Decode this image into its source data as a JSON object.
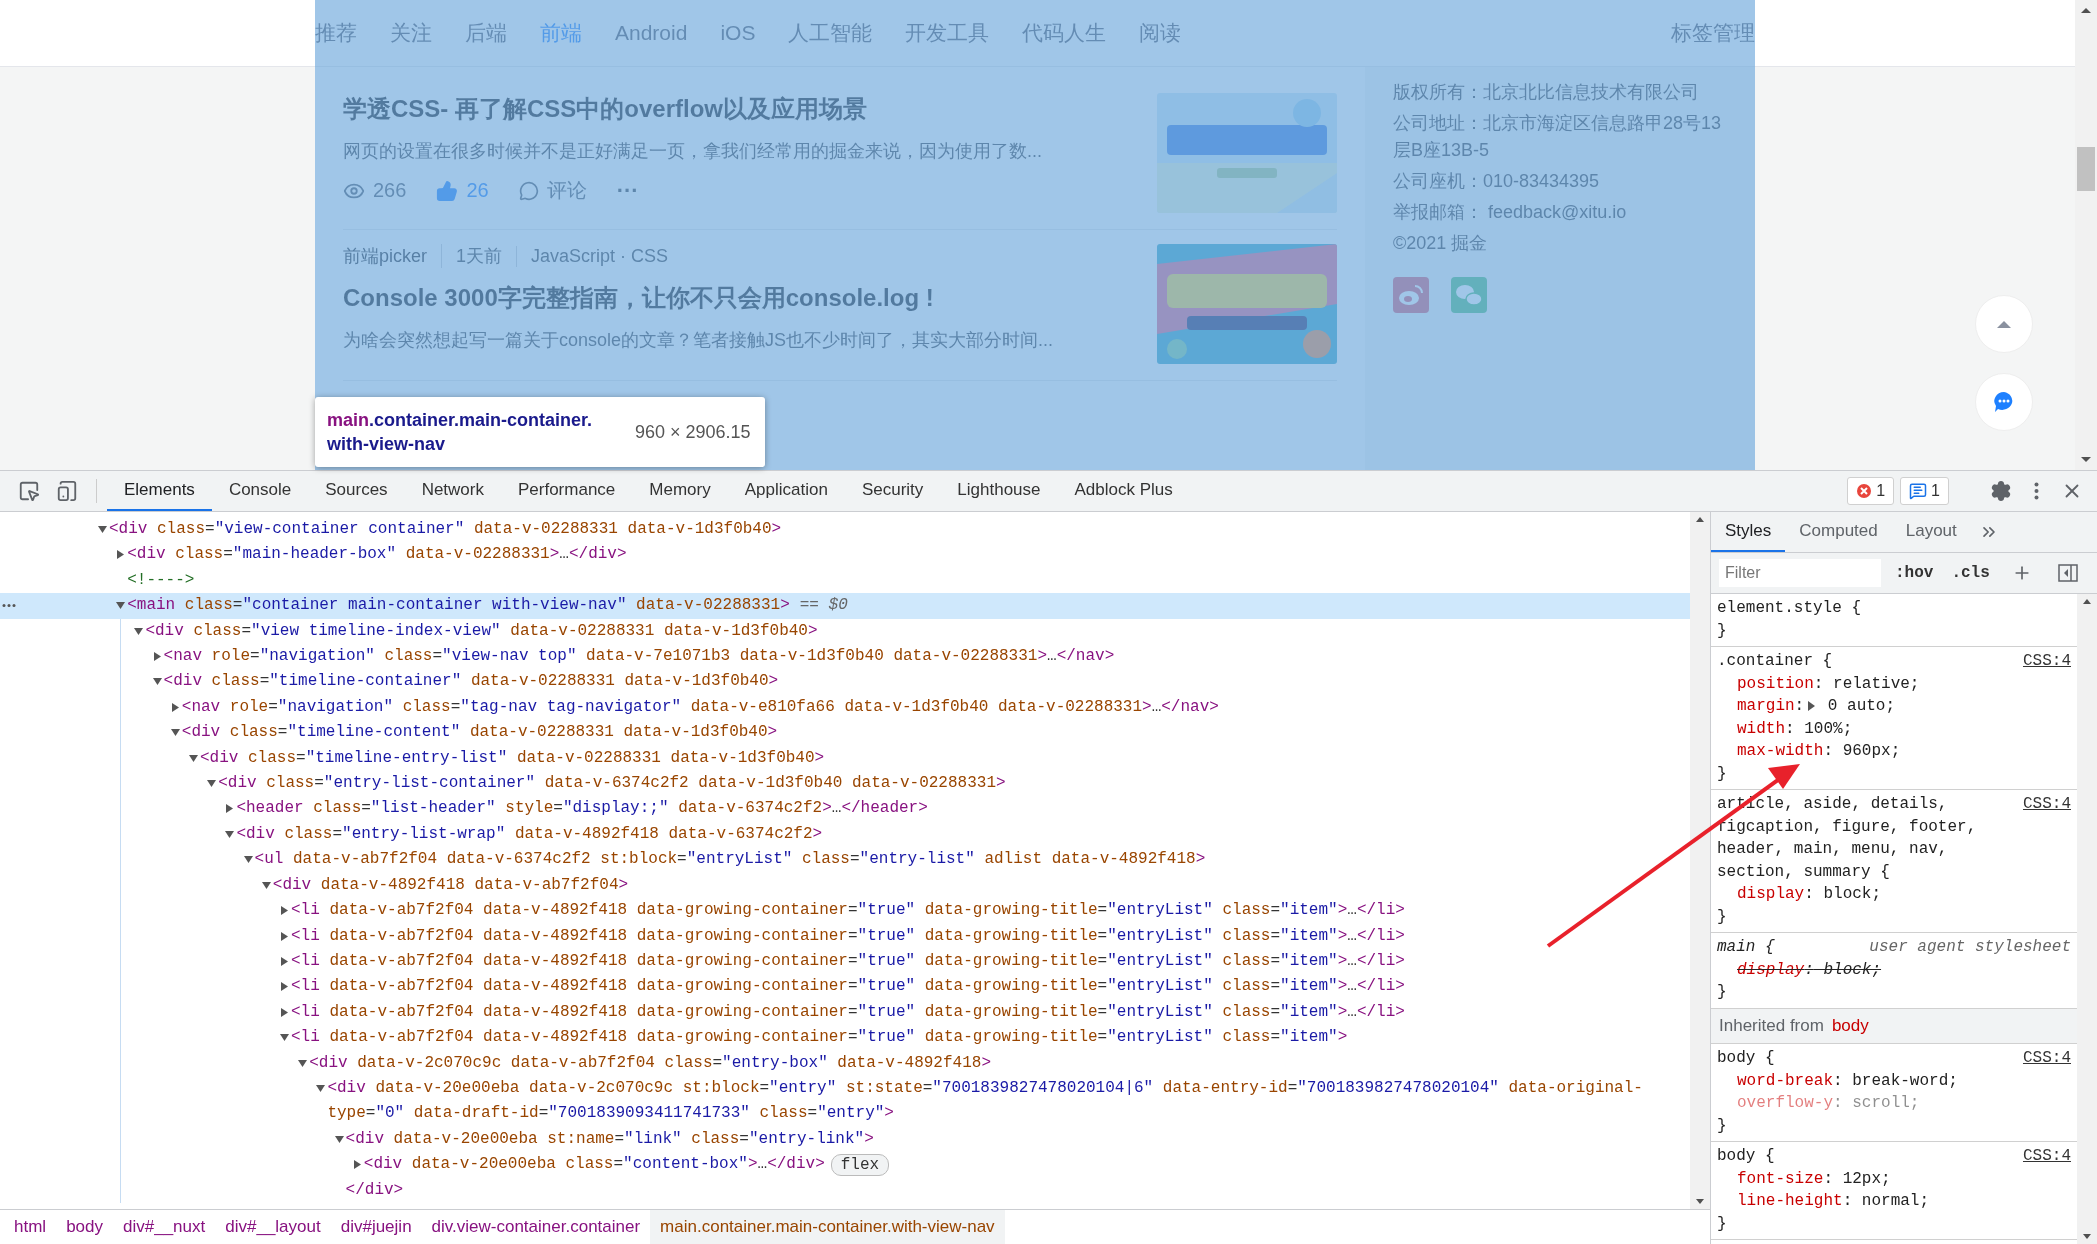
{
  "page": {
    "nav": [
      {
        "label": "推荐",
        "selected": false
      },
      {
        "label": "关注",
        "selected": false
      },
      {
        "label": "后端",
        "selected": false
      },
      {
        "label": "前端",
        "selected": true
      },
      {
        "label": "Android",
        "selected": false
      },
      {
        "label": "iOS",
        "selected": false
      },
      {
        "label": "人工智能",
        "selected": false
      },
      {
        "label": "开发工具",
        "selected": false
      },
      {
        "label": "代码人生",
        "selected": false
      },
      {
        "label": "阅读",
        "selected": false
      }
    ],
    "nav_link": "标签管理",
    "articles": [
      {
        "title": "学透CSS- 再了解CSS中的overflow以及应用场景",
        "excerpt": "网页的设置在很多时候并不是正好满足一页，拿我们经常用的掘金来说，因为使用了数...",
        "stats": {
          "views": "266",
          "likes": "26",
          "liked": true,
          "comments": "评论",
          "more": "···"
        }
      },
      {
        "meta": {
          "author": "前端picker",
          "time": "1天前",
          "tags": "JavaScript · CSS"
        },
        "title": "Console 3000字完整指南，让你不只会用console.log !",
        "excerpt": "为啥会突然想起写一篇关于console的文章？笔者接触JS也不少时间了，其实大部分时间..."
      }
    ],
    "footer_lines": [
      "版权所有：北京北比信息技术有限公司",
      "公司地址：北京市海淀区信息路甲28号13层B座13B-5",
      "公司座机：010-83434395",
      "举报邮箱： feedback@xitu.io",
      "©2021 掘金"
    ],
    "inspect_tooltip": {
      "tag": "main",
      "classes": ".container.main-container.with-view-nav",
      "size": "960 × 2906.15"
    }
  },
  "devtools": {
    "tabs": [
      {
        "label": "Elements",
        "selected": true
      },
      {
        "label": "Console",
        "selected": false
      },
      {
        "label": "Sources",
        "selected": false
      },
      {
        "label": "Network",
        "selected": false
      },
      {
        "label": "Performance",
        "selected": false
      },
      {
        "label": "Memory",
        "selected": false
      },
      {
        "label": "Application",
        "selected": false
      },
      {
        "label": "Security",
        "selected": false
      },
      {
        "label": "Lighthouse",
        "selected": false
      },
      {
        "label": "Adblock Plus",
        "selected": false
      }
    ],
    "errors": "1",
    "messages": "1",
    "dom_tree": [
      {
        "kind": "element",
        "markup": "<div class=\"view-container container\" data-v-02288331 data-v-1d3f0b40>",
        "expanded": true,
        "selected": false,
        "children": [
          {
            "kind": "element",
            "markup": "<div class=\"main-header-box\" data-v-02288331>…</div>",
            "expanded": false,
            "selected": false
          },
          {
            "kind": "comment",
            "markup": "<!---->",
            "selected": false
          },
          {
            "kind": "element",
            "markup": "<main class=\"container main-container with-view-nav\" data-v-02288331>",
            "suffix": "== $0",
            "expanded": true,
            "selected": true,
            "children": [
              {
                "kind": "element",
                "markup": "<div class=\"view timeline-index-view\" data-v-02288331 data-v-1d3f0b40>",
                "expanded": true,
                "selected": false,
                "children": [
                  {
                    "kind": "element",
                    "markup": "<nav role=\"navigation\" class=\"view-nav top\" data-v-7e1071b3 data-v-1d3f0b40 data-v-02288331>…</nav>",
                    "expanded": false,
                    "selected": false
                  },
                  {
                    "kind": "element",
                    "markup": "<div class=\"timeline-container\" data-v-02288331 data-v-1d3f0b40>",
                    "expanded": true,
                    "selected": false,
                    "children": [
                      {
                        "kind": "element",
                        "markup": "<nav role=\"navigation\" class=\"tag-nav tag-navigator\" data-v-e810fa66 data-v-1d3f0b40 data-v-02288331>…</nav>",
                        "expanded": false,
                        "selected": false
                      },
                      {
                        "kind": "element",
                        "markup": "<div class=\"timeline-content\" data-v-02288331 data-v-1d3f0b40>",
                        "expanded": true,
                        "selected": false,
                        "children": [
                          {
                            "kind": "element",
                            "markup": "<div class=\"timeline-entry-list\" data-v-02288331 data-v-1d3f0b40>",
                            "expanded": true,
                            "selected": false,
                            "children": [
                              {
                                "kind": "element",
                                "markup": "<div class=\"entry-list-container\" data-v-6374c2f2 data-v-1d3f0b40 data-v-02288331>",
                                "expanded": true,
                                "selected": false,
                                "children": [
                                  {
                                    "kind": "element",
                                    "markup": "<header class=\"list-header\" style=\"display:;\" data-v-6374c2f2>…</header>",
                                    "expanded": false,
                                    "selected": false
                                  },
                                  {
                                    "kind": "element",
                                    "markup": "<div class=\"entry-list-wrap\" data-v-4892f418 data-v-6374c2f2>",
                                    "expanded": true,
                                    "selected": false,
                                    "children": [
                                      {
                                        "kind": "element",
                                        "markup": "<ul data-v-ab7f2f04 data-v-6374c2f2 st:block=\"entryList\" class=\"entry-list\" adlist data-v-4892f418>",
                                        "expanded": true,
                                        "selected": false,
                                        "children": [
                                          {
                                            "kind": "element",
                                            "markup": "<div data-v-4892f418 data-v-ab7f2f04>",
                                            "expanded": true,
                                            "selected": false,
                                            "children": [
                                              {
                                                "kind": "element",
                                                "markup": "<li data-v-ab7f2f04 data-v-4892f418 data-growing-container=\"true\" data-growing-title=\"entryList\" class=\"item\">…</li>",
                                                "expanded": false,
                                                "selected": false
                                              },
                                              {
                                                "kind": "element",
                                                "markup": "<li data-v-ab7f2f04 data-v-4892f418 data-growing-container=\"true\" data-growing-title=\"entryList\" class=\"item\">…</li>",
                                                "expanded": false,
                                                "selected": false
                                              },
                                              {
                                                "kind": "element",
                                                "markup": "<li data-v-ab7f2f04 data-v-4892f418 data-growing-container=\"true\" data-growing-title=\"entryList\" class=\"item\">…</li>",
                                                "expanded": false,
                                                "selected": false
                                              },
                                              {
                                                "kind": "element",
                                                "markup": "<li data-v-ab7f2f04 data-v-4892f418 data-growing-container=\"true\" data-growing-title=\"entryList\" class=\"item\">…</li>",
                                                "expanded": false,
                                                "selected": false
                                              },
                                              {
                                                "kind": "element",
                                                "markup": "<li data-v-ab7f2f04 data-v-4892f418 data-growing-container=\"true\" data-growing-title=\"entryList\" class=\"item\">…</li>",
                                                "expanded": false,
                                                "selected": false
                                              },
                                              {
                                                "kind": "element",
                                                "markup": "<li data-v-ab7f2f04 data-v-4892f418 data-growing-container=\"true\" data-growing-title=\"entryList\" class=\"item\">",
                                                "expanded": true,
                                                "selected": false,
                                                "children": [
                                                  {
                                                    "kind": "element",
                                                    "markup": "<div data-v-2c070c9c data-v-ab7f2f04 class=\"entry-box\" data-v-4892f418>",
                                                    "expanded": true,
                                                    "selected": false,
                                                    "children": [
                                                      {
                                                        "kind": "element",
                                                        "markup": "<div data-v-20e00eba data-v-2c070c9c st:block=\"entry\" st:state=\"7001839827478020104|6\" data-entry-id=\"7001839827478020104\" data-original-type=\"0\" data-draft-id=\"7001839093411741733\" class=\"entry\">",
                                                        "expanded": true,
                                                        "selected": false,
                                                        "children": [
                                                          {
                                                            "kind": "element",
                                                            "markup": "<div data-v-20e00eba st:name=\"link\" class=\"entry-link\">",
                                                            "expanded": true,
                                                            "selected": false,
                                                            "closing": "</div>",
                                                            "children": [
                                                              {
                                                                "kind": "element",
                                                                "markup": "<div data-v-20e00eba class=\"content-box\">…</div>",
                                                                "badge": "flex",
                                                                "expanded": false,
                                                                "selected": false
                                                              }
                                                            ]
                                                          }
                                                        ]
                                                      }
                                                    ]
                                                  }
                                                ]
                                              }
                                            ]
                                          }
                                        ]
                                      }
                                    ]
                                  }
                                ]
                              }
                            ]
                          }
                        ]
                      }
                    ]
                  }
                ]
              }
            ]
          }
        ]
      }
    ],
    "breadcrumbs": [
      {
        "label": "html",
        "selected": false
      },
      {
        "label": "body",
        "selected": false
      },
      {
        "label": "div#__nuxt",
        "selected": false
      },
      {
        "label": "div#__layout",
        "selected": false
      },
      {
        "label": "div#juejin",
        "selected": false
      },
      {
        "label": "div.view-container.container",
        "selected": false
      },
      {
        "label": "main.container.main-container.with-view-nav",
        "selected": true
      }
    ],
    "styles": {
      "tabs": [
        {
          "label": "Styles",
          "selected": true
        },
        {
          "label": "Computed",
          "selected": false
        },
        {
          "label": "Layout",
          "selected": false
        }
      ],
      "filter": {
        "placeholder": "Filter"
      },
      "hov": ":hov",
      "cls": ".cls",
      "rules": [
        {
          "kind": "rule",
          "user_agent": false,
          "selector": "element.style {",
          "close": "}"
        },
        {
          "kind": "rule",
          "user_agent": false,
          "selector": ".container {",
          "source": "CSS:4",
          "close": "}",
          "declarations": [
            {
              "text": "position: relative;",
              "overridden": false,
              "inactive": false,
              "expandable": false
            },
            {
              "text": "margin: 0 auto;",
              "overridden": false,
              "inactive": false,
              "expandable": true
            },
            {
              "text": "width: 100%;",
              "overridden": false,
              "inactive": false,
              "expandable": false
            },
            {
              "text": "max-width: 960px;",
              "overridden": false,
              "inactive": false,
              "expandable": false
            }
          ]
        },
        {
          "kind": "rule",
          "user_agent": false,
          "selector": "article, aside, details, figcaption, figure, footer, header, main, menu, nav, section, summary {",
          "source": "CSS:4",
          "close": "}",
          "declarations": [
            {
              "text": "display: block;",
              "overridden": false,
              "inactive": false,
              "expandable": false
            }
          ]
        },
        {
          "kind": "rule",
          "user_agent": true,
          "selector": "main {",
          "source": "user agent stylesheet",
          "close": "}",
          "declarations": [
            {
              "text": "display: block;",
              "overridden": true,
              "inactive": false,
              "expandable": false
            }
          ]
        },
        {
          "kind": "inherited",
          "label": "Inherited from",
          "target": "body"
        },
        {
          "kind": "rule",
          "user_agent": false,
          "selector": "body {",
          "source": "CSS:4",
          "close": "}",
          "declarations": [
            {
              "text": "word-break: break-word;",
              "overridden": false,
              "inactive": false,
              "expandable": false
            },
            {
              "text": "overflow-y: scroll;",
              "overridden": false,
              "inactive": true,
              "expandable": false
            }
          ]
        },
        {
          "kind": "rule",
          "user_agent": false,
          "selector": "body {",
          "source": "CSS:4",
          "close": "}",
          "declarations": [
            {
              "text": "font-size: 12px;",
              "overridden": false,
              "inactive": false,
              "expandable": false
            },
            {
              "text": "line-height: normal;",
              "overridden": false,
              "inactive": false,
              "expandable": false
            }
          ]
        }
      ]
    }
  },
  "annotations": [
    {
      "kind": "arrow"
    }
  ]
}
